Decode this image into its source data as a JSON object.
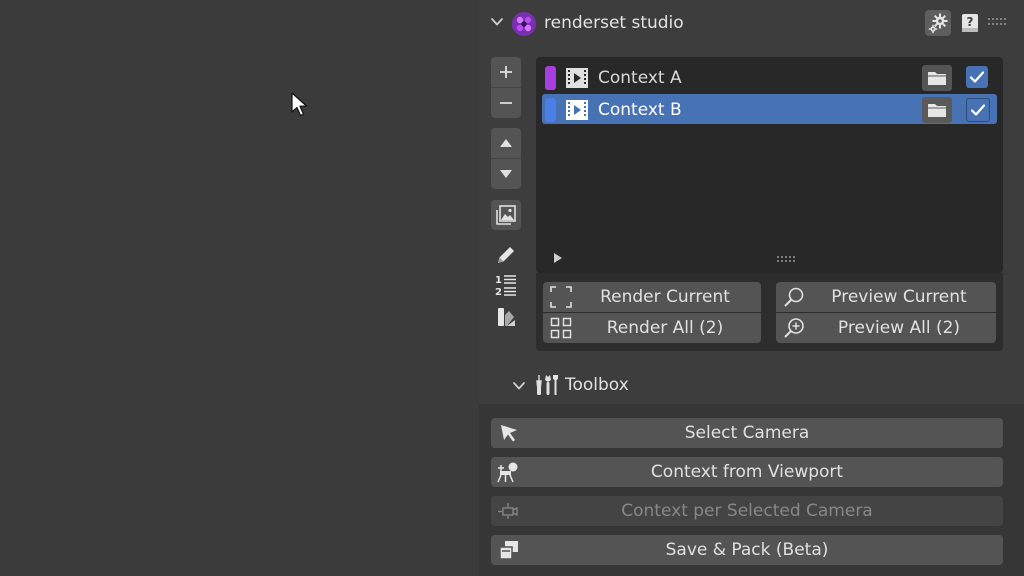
{
  "header": {
    "title": "renderset studio",
    "icons": {
      "collapse": "chevron-down-icon",
      "logo": "renderset-logo-icon",
      "preferences": "gear-icon",
      "help": "help-book-icon",
      "drag": "drag-grip-icon"
    }
  },
  "side_tools": {
    "icons": [
      "plus-icon",
      "minus-icon",
      "arrow-up-icon",
      "arrow-down-icon",
      "image-stack-icon",
      "pencil-icon",
      "numbered-list-icon",
      "palette-icon"
    ]
  },
  "contexts": {
    "items": [
      {
        "label": "Context A",
        "color": "#a93ee0",
        "enabled": true,
        "selected": false
      },
      {
        "label": "Context B",
        "color": "#4a7fe6",
        "enabled": true,
        "selected": true
      }
    ]
  },
  "render": {
    "render_current": "Render Current",
    "render_all": "Render All (2)",
    "preview_current": "Preview Current",
    "preview_all": "Preview All (2)"
  },
  "toolbox": {
    "title": "Toolbox",
    "buttons": {
      "select_camera": "Select Camera",
      "context_from_viewport": "Context from Viewport",
      "context_per_selected_camera": "Context per Selected Camera",
      "save_pack": "Save & Pack (Beta)"
    }
  },
  "colors": {
    "accent": "#4772b3",
    "panel_bg": "#3d3d3d",
    "list_bg": "#282828",
    "button_bg": "#545454"
  }
}
